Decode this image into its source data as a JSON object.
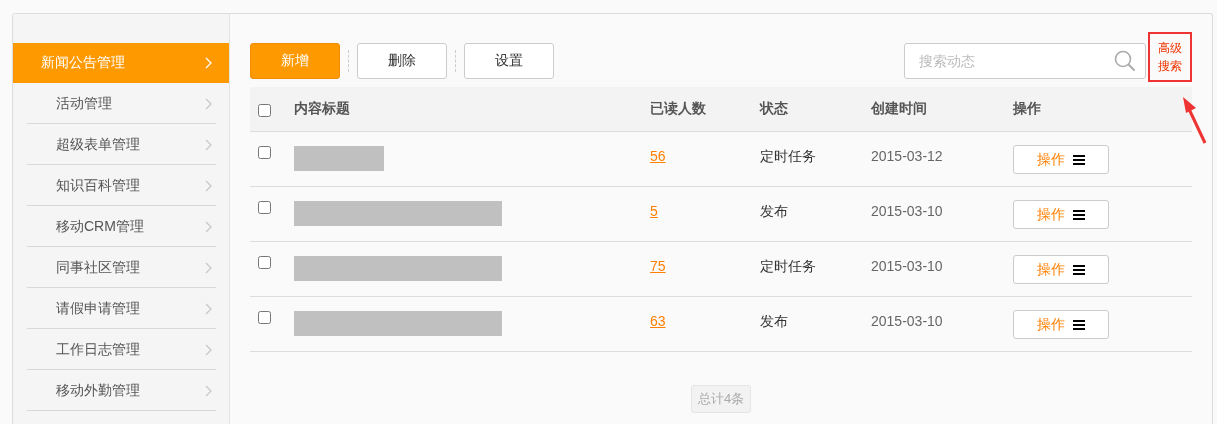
{
  "sidebar": {
    "items": [
      {
        "label": "新闻公告管理",
        "selected": true
      },
      {
        "label": "活动管理",
        "selected": false
      },
      {
        "label": "超级表单管理",
        "selected": false
      },
      {
        "label": "知识百科管理",
        "selected": false
      },
      {
        "label": "移动CRM管理",
        "selected": false
      },
      {
        "label": "同事社区管理",
        "selected": false
      },
      {
        "label": "请假申请管理",
        "selected": false
      },
      {
        "label": "工作日志管理",
        "selected": false
      },
      {
        "label": "移动外勤管理",
        "selected": false
      }
    ]
  },
  "toolbar": {
    "buttons": [
      {
        "label": "新增",
        "kind": "primary"
      },
      {
        "label": "删除",
        "kind": "plain"
      },
      {
        "label": "设置",
        "kind": "plain"
      }
    ],
    "search": {
      "placeholder": "搜索动态"
    },
    "advanced_search": [
      "高级",
      "搜索"
    ]
  },
  "table": {
    "select_all_checked": false,
    "columns": [
      "内容标题",
      "已读人数",
      "状态",
      "创建时间",
      "操作"
    ],
    "rows": [
      {
        "checked": false,
        "reads": "56",
        "status": "定时任务",
        "created": "2015-03-12",
        "action": "操作"
      },
      {
        "checked": false,
        "reads": "5",
        "status": "发布",
        "created": "2015-03-10",
        "action": "操作"
      },
      {
        "checked": false,
        "reads": "75",
        "status": "定时任务",
        "created": "2015-03-10",
        "action": "操作"
      },
      {
        "checked": false,
        "reads": "63",
        "status": "发布",
        "created": "2015-03-10",
        "action": "操作"
      }
    ]
  },
  "footer": {
    "total": "总计4条"
  }
}
